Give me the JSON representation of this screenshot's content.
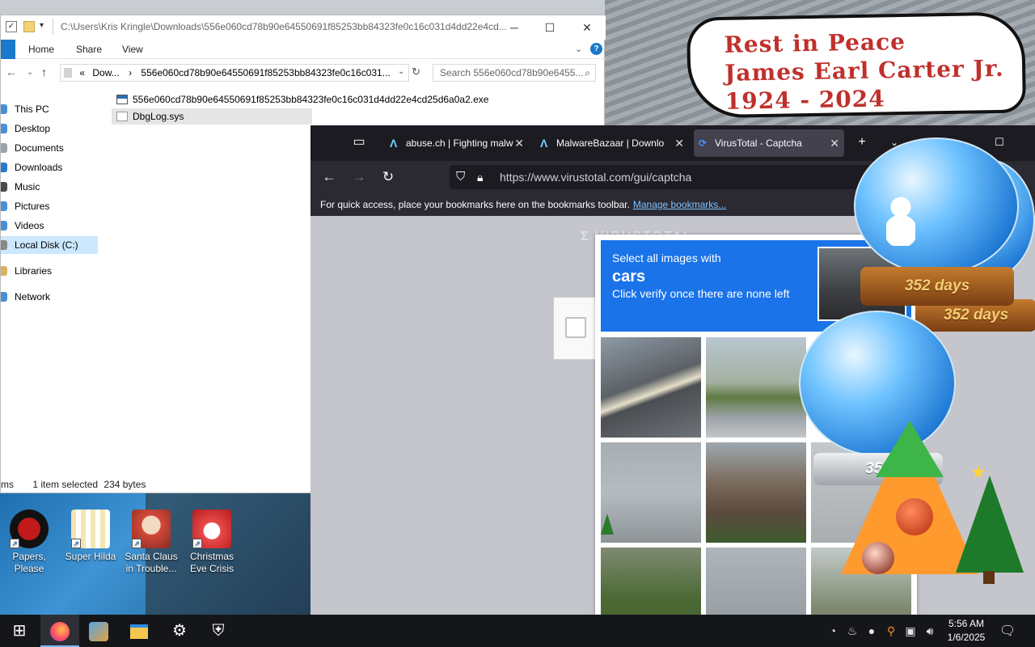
{
  "banner": {
    "line1": "Rest in Peace",
    "line2": "James Earl Carter Jr.",
    "line3": "1924 - 2024"
  },
  "explorer": {
    "title_path": "C:\\Users\\Kris Kringle\\Downloads\\556e060cd78b90e64550691f85253bb84323fe0c16c031d4dd22e4cd...",
    "ribbon": {
      "home": "Home",
      "share": "Share",
      "view": "View",
      "help": "?"
    },
    "address": {
      "prefix": "«",
      "segment1": "Dow...",
      "sep": "›",
      "segment2": "556e060cd78b90e64550691f85253bb84323fe0c16c031..."
    },
    "search_placeholder": "Search 556e060cd78b90e6455...",
    "sidebar": [
      {
        "label": "This PC"
      },
      {
        "label": "Desktop"
      },
      {
        "label": "Documents"
      },
      {
        "label": "Downloads"
      },
      {
        "label": "Music"
      },
      {
        "label": "Pictures"
      },
      {
        "label": "Videos"
      },
      {
        "label": "Local Disk (C:)"
      },
      {
        "label": "Libraries"
      },
      {
        "label": "Network"
      }
    ],
    "files": [
      {
        "name": "556e060cd78b90e64550691f85253bb84323fe0c16c031d4dd22e4cd25d6a0a2.exe"
      },
      {
        "name": "DbgLog.sys"
      }
    ],
    "status": {
      "items": "ms",
      "selected": "1 item selected",
      "size": "234 bytes"
    }
  },
  "desktop_icons": [
    {
      "label": "Papers, Please"
    },
    {
      "label": "Super Hilda"
    },
    {
      "label": "Santa Claus in Trouble..."
    },
    {
      "label": "Christmas Eve Crisis"
    }
  ],
  "browser": {
    "tabs": [
      {
        "label": "abuse.ch | Fighting malw"
      },
      {
        "label": "MalwareBazaar | Downlo"
      },
      {
        "label": "VirusTotal - Captcha"
      }
    ],
    "new_tab": "+",
    "url": "https://www.virustotal.com/gui/captcha",
    "bookmarks_text": "For quick access, place your bookmarks here on the bookmarks toolbar.",
    "bookmarks_link": "Manage bookmarks..."
  },
  "captcha": {
    "instruction": "Select all images with",
    "object": "cars",
    "hint": "Click verify once there are none left"
  },
  "decorations": {
    "globe1_days": "352 days",
    "globe2_days": "352 days",
    "globe3_days": "352"
  },
  "taskbar": {
    "time": "5:56 AM",
    "date": "1/6/2025"
  },
  "colors": {
    "captcha_blue": "#1a73e8",
    "browser_dark": "#1c1b22",
    "explorer_accent": "#1979ca",
    "banner_red": "#c0302c"
  }
}
